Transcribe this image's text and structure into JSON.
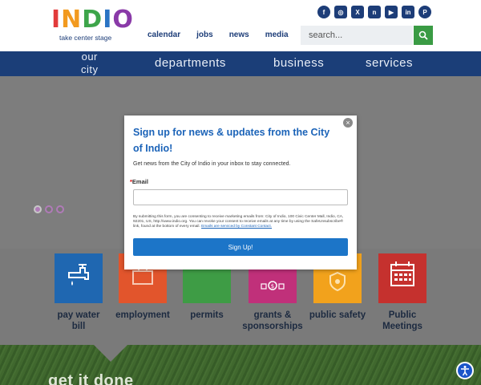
{
  "logo": {
    "word": [
      "I",
      "N",
      "D",
      "I",
      "O"
    ],
    "tagline": "take center stage"
  },
  "social": [
    {
      "icon": "facebook-icon",
      "glyph": "f"
    },
    {
      "icon": "instagram-icon",
      "glyph": "◎"
    },
    {
      "icon": "x-icon",
      "glyph": "X"
    },
    {
      "icon": "nextdoor-icon",
      "glyph": "n"
    },
    {
      "icon": "youtube-icon",
      "glyph": "▶"
    },
    {
      "icon": "linkedin-icon",
      "glyph": "in"
    },
    {
      "icon": "pinterest-icon",
      "glyph": "P"
    }
  ],
  "topnav": [
    "calendar",
    "jobs",
    "news",
    "media"
  ],
  "search": {
    "placeholder": "search..."
  },
  "mainnav": {
    "our_city_line1": "our",
    "our_city_line2": "city",
    "departments": "departments",
    "business": "business",
    "services": "services"
  },
  "tiles": [
    {
      "label_line1": "pay water",
      "label_line2": "bill",
      "color": "#1f67b1",
      "icon": "water-faucet-icon"
    },
    {
      "label_line1": "employment",
      "label_line2": "",
      "color": "#e2552c",
      "icon": "briefcase-icon"
    },
    {
      "label_line1": "permits",
      "label_line2": "",
      "color": "#3e9c45",
      "icon": "permit-icon"
    },
    {
      "label_line1": "grants &",
      "label_line2": "sponsorships",
      "color": "#c0307a",
      "icon": "money-icon"
    },
    {
      "label_line1": "public safety",
      "label_line2": "",
      "color": "#f2a21c",
      "icon": "badge-icon"
    },
    {
      "label_line1": "Public",
      "label_line2": "Meetings",
      "color": "#c5312e",
      "icon": "calendar-icon"
    }
  ],
  "band": {
    "heading": "get it done"
  },
  "modal": {
    "title": "Sign up for news & updates from the City of Indio!",
    "subtitle": "Get news from the City of Indio in your inbox to stay connected.",
    "email_label": "Email",
    "email_required": "*",
    "legal": "By submitting this form, you are consenting to receive marketing emails from: City of Indio, 100 Civic Center Mall, Indio, CA, 92201, US, http://www.indio.org. You can revoke your consent to receive emails at any time by using the SafeUnsubscribe® link, found at the bottom of every email.",
    "legal_link": "Emails are serviced by Constant Contact.",
    "button": "Sign Up!",
    "close": "×"
  },
  "colors": {
    "navy": "#1b3e78",
    "green": "#3a9b44",
    "modal_blue": "#1b63b8",
    "signup_blue": "#1c75c8"
  }
}
